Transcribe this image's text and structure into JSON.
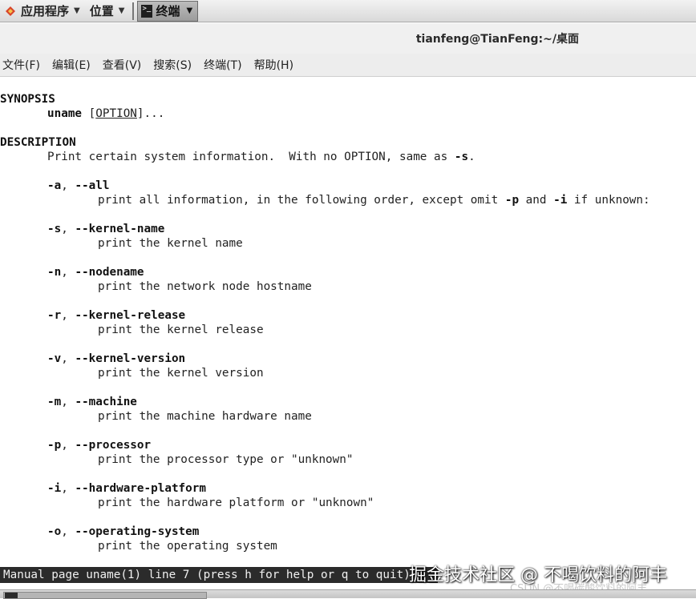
{
  "panel": {
    "apps_label": "应用程序",
    "places_label": "位置",
    "terminal_task_label": "终端"
  },
  "window": {
    "title": "tianfeng@TianFeng:~/桌面"
  },
  "menu": {
    "items": [
      "文件(F)",
      "编辑(E)",
      "查看(V)",
      "搜索(S)",
      "终端(T)",
      "帮助(H)"
    ]
  },
  "man": {
    "synopsis_heading": "SYNOPSIS",
    "synopsis_cmd": "uname",
    "synopsis_bracket_open": " [",
    "synopsis_option": "OPTION",
    "synopsis_rest": "]...",
    "description_heading": "DESCRIPTION",
    "description_text": "Print certain system information.  With no OPTION, same as ",
    "description_flag": "-s",
    "description_end": ".",
    "options": [
      {
        "short": "-a",
        "long": "--all",
        "desc": "print all information, in the following order, except omit ",
        "extra": true
      },
      {
        "short": "-s",
        "long": "--kernel-name",
        "desc": "print the kernel name"
      },
      {
        "short": "-n",
        "long": "--nodename",
        "desc": "print the network node hostname"
      },
      {
        "short": "-r",
        "long": "--kernel-release",
        "desc": "print the kernel release"
      },
      {
        "short": "-v",
        "long": "--kernel-version",
        "desc": "print the kernel version"
      },
      {
        "short": "-m",
        "long": "--machine",
        "desc": "print the machine hardware name"
      },
      {
        "short": "-p",
        "long": "--processor",
        "desc": "print the processor type or \"unknown\""
      },
      {
        "short": "-i",
        "long": "--hardware-platform",
        "desc": "print the hardware platform or \"unknown\""
      },
      {
        "short": "-o",
        "long": "--operating-system",
        "desc": "print the operating system"
      }
    ],
    "all_flag_p": "-p",
    "all_and": " and ",
    "all_flag_i": "-i",
    "all_tail": " if unknown:",
    "sep": ", "
  },
  "status": {
    "text": "Manual page uname(1) line 7 (press h for help or q to quit)"
  },
  "watermark": {
    "big": "掘金技术社区 @ 不喝饮料的阿丰",
    "small": "CSDN @不喝碳酸饮料的阿丰"
  }
}
